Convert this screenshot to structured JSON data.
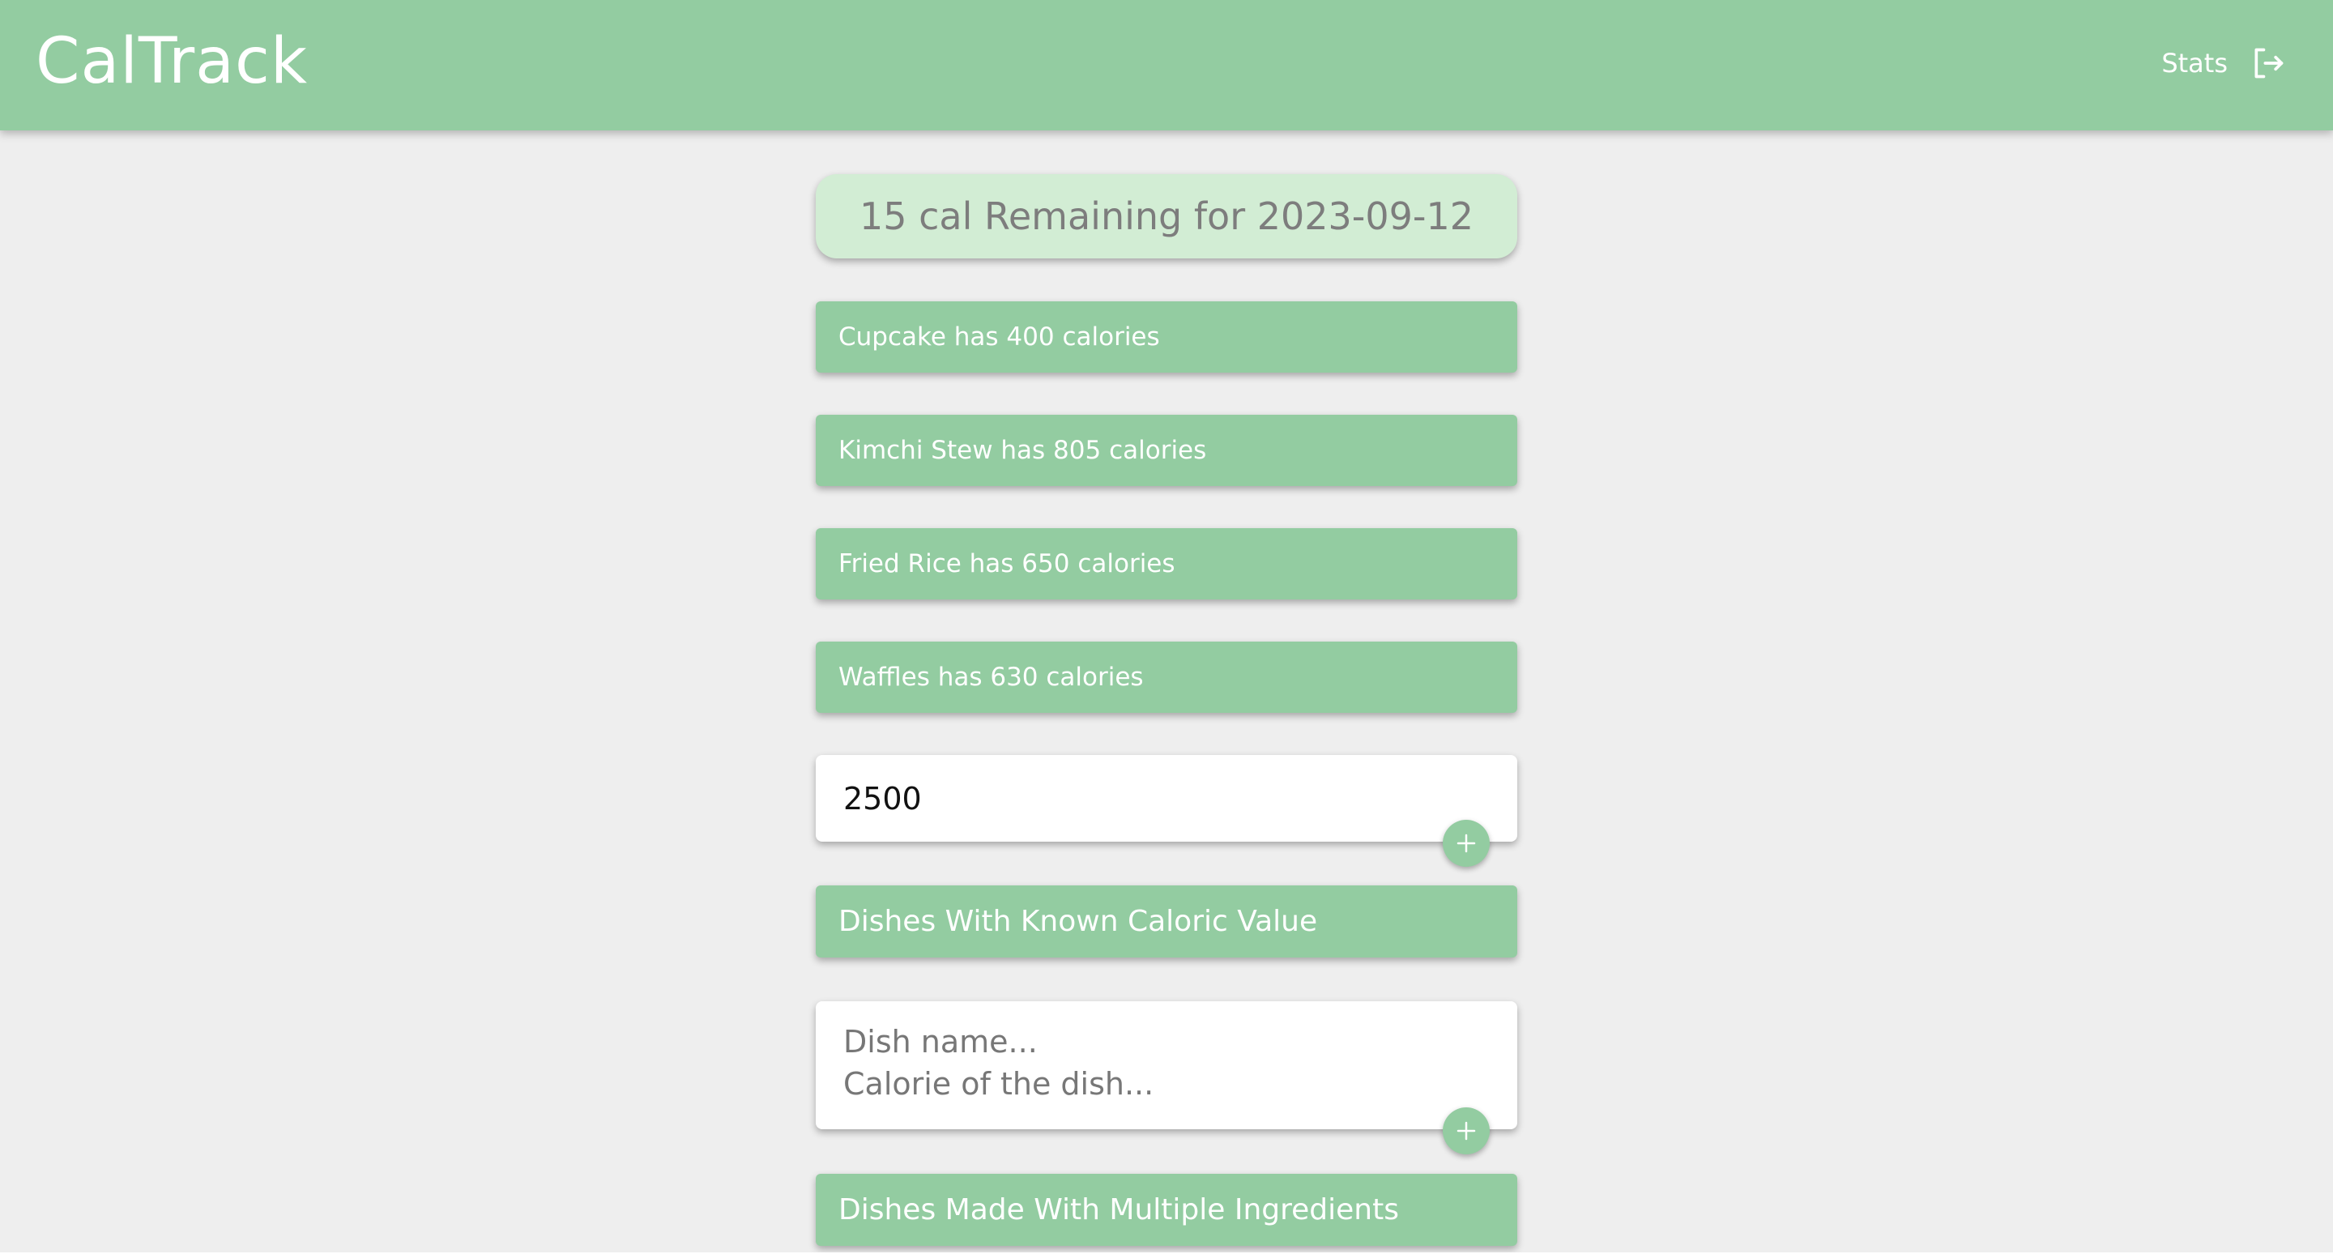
{
  "header": {
    "logo": "CalTrack",
    "nav_stats": "Stats",
    "logout_icon": "logout-icon"
  },
  "summary": {
    "remaining_text": "15 cal Remaining for 2023-09-12"
  },
  "meals": [
    {
      "label": "Cupcake has 400 calories"
    },
    {
      "label": "Kimchi Stew has 805 calories"
    },
    {
      "label": "Fried Rice has 650 calories"
    },
    {
      "label": "Waffles has 630 calories"
    }
  ],
  "calorie_goal": {
    "value": "2500",
    "add_icon": "plus-icon"
  },
  "known_dishes": {
    "title": "Dishes With Known Caloric Value",
    "name_placeholder": "Dish name...",
    "calorie_placeholder": "Calorie of the dish...",
    "add_icon": "plus-icon"
  },
  "multi_ingredient": {
    "title": "Dishes Made With Multiple Ingredients"
  },
  "colors": {
    "primary_green": "#93cca1",
    "light_green": "#d2edd4",
    "background": "#eeeeee"
  }
}
